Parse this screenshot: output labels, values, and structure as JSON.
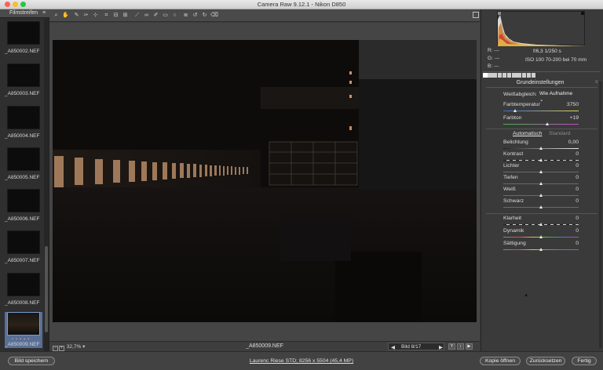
{
  "window": {
    "title": "Camera Raw 9.12.1 - Nikon D850"
  },
  "toolbar": {
    "tools": [
      "zoom-icon",
      "hand-icon",
      "white-balance-icon",
      "color-sampler-icon",
      "targeted-adjustment-icon",
      "crop-icon",
      "straighten-icon",
      "transform-icon",
      "spot-removal-icon",
      "red-eye-icon",
      "adjustment-brush-icon",
      "graduated-filter-icon",
      "radial-filter-icon",
      "preferences-icon",
      "rotate-left-icon",
      "rotate-right-icon",
      "delete-icon"
    ]
  },
  "filmstrip": {
    "title": "Filmstreifen",
    "items": [
      {
        "label": "_A850002.NEF"
      },
      {
        "label": "_A850003.NEF"
      },
      {
        "label": "_A850004.NEF"
      },
      {
        "label": "_A850005.NEF"
      },
      {
        "label": "_A850006.NEF"
      },
      {
        "label": "_A850007.NEF"
      },
      {
        "label": "_A850008.NEF"
      },
      {
        "label": "_A850009.NEF",
        "selected": true,
        "rating": "• • • • •"
      }
    ]
  },
  "status": {
    "zoom": "32,7%",
    "filename": "_A850009.NEF",
    "image_counter": "Bild 8/17",
    "view_buttons": [
      "Y",
      "↕",
      "▶"
    ]
  },
  "camera_info": {
    "r": "R:   ---",
    "g": "G:   ---",
    "b": "B:   ---",
    "exposure": "f/6,3   1/250 s",
    "iso_lens": "ISO 100   70-200 bei 70 mm"
  },
  "panel": {
    "section_title": "Grundeinstellungen",
    "white_balance": {
      "label": "Weißabgleich:",
      "value": "Wie Aufnahme"
    },
    "tone_auto": "Automatisch",
    "tone_standard": "Standard",
    "sliders": [
      {
        "key": "temp",
        "label": "Farbtemperatur",
        "value": "3750",
        "pos": 0.16
      },
      {
        "key": "tint",
        "label": "Farbton",
        "value": "+19",
        "pos": 0.59
      },
      {
        "key": "exposure",
        "label": "Belichtung",
        "value": "0,00",
        "pos": 0.5
      },
      {
        "key": "contrast",
        "label": "Kontrast",
        "value": "0",
        "pos": 0.5
      },
      {
        "key": "highlights",
        "label": "Lichter",
        "value": "0",
        "pos": 0.5
      },
      {
        "key": "shadows",
        "label": "Tiefen",
        "value": "0",
        "pos": 0.5
      },
      {
        "key": "whites",
        "label": "Weiß",
        "value": "0",
        "pos": 0.5
      },
      {
        "key": "blacks",
        "label": "Schwarz",
        "value": "0",
        "pos": 0.5
      },
      {
        "key": "clarity",
        "label": "Klarheit",
        "value": "0",
        "pos": 0.5
      },
      {
        "key": "vibrance",
        "label": "Dynamik",
        "value": "0",
        "pos": 0.5
      },
      {
        "key": "saturation",
        "label": "Sättigung",
        "value": "0",
        "pos": 0.5
      }
    ]
  },
  "bottom": {
    "save_label": "Bild speichern",
    "workflow_label": "Laurenc Riese STD; 8256 x 5504 (45,4 MP)",
    "open_copy_label": "Kopie öffnen",
    "reset_label": "Zurücksetzen",
    "done_label": "Fertig"
  }
}
